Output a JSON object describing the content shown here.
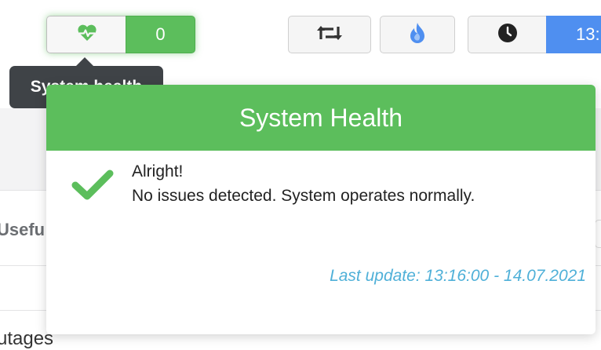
{
  "toolbar": {
    "health_count": "0",
    "time_text": "13:",
    "icons": [
      "heartbeat-icon",
      "retweet-icon",
      "fire-icon",
      "clock-icon"
    ],
    "accent_green": "#5cbe5c",
    "accent_blue": "#4f8ff0"
  },
  "tooltip": {
    "text": "System health"
  },
  "popover": {
    "title": "System Health",
    "status_title": "Alright!",
    "status_message": "No issues detected. System operates normally.",
    "last_update": "Last update: 13:16:00 - 14.07.2021"
  },
  "background": {
    "partial_label_1": "Usefu",
    "partial_label_2": "utages"
  }
}
